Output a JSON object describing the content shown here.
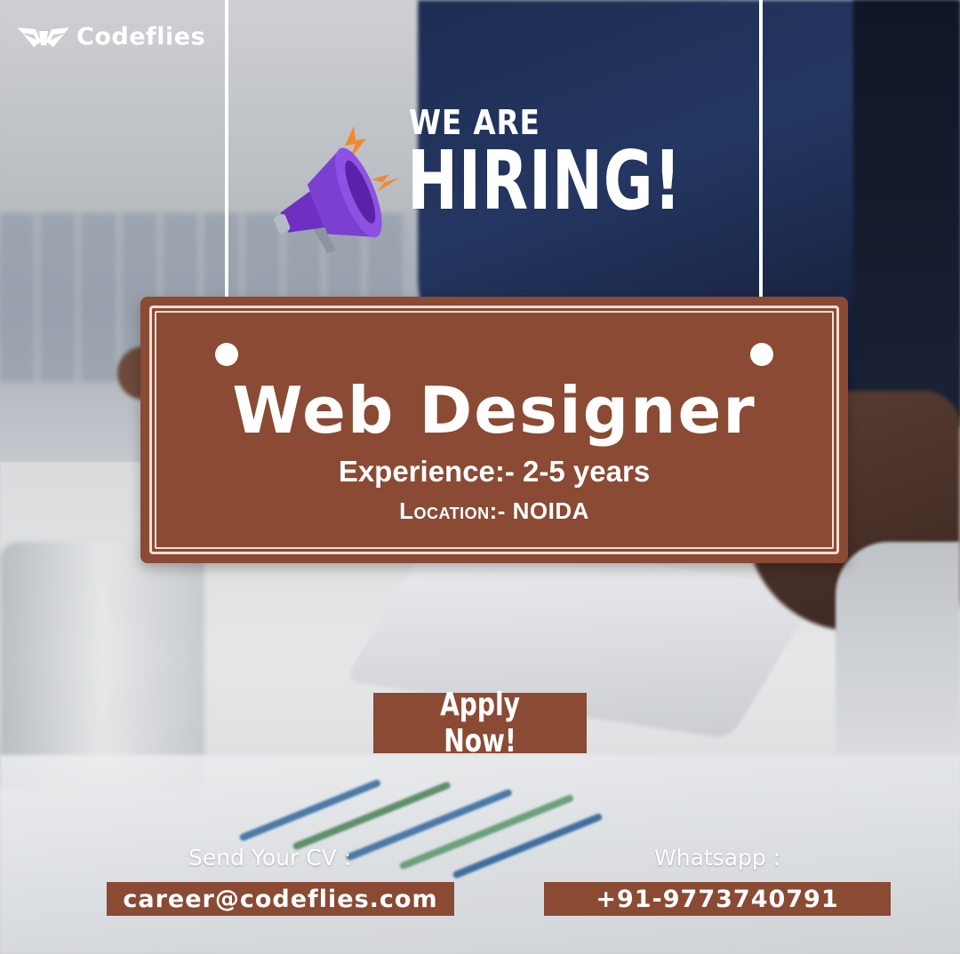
{
  "brand": {
    "name": "Codeflies",
    "logo_icon": "wings-logo-icon"
  },
  "headline": {
    "line1": "WE ARE",
    "line2": "HIRING!",
    "icon": "megaphone-icon"
  },
  "job": {
    "title": "Web Designer",
    "experience": "Experience:- 2-5 years",
    "location": "Location:- NOIDA"
  },
  "cta": {
    "label": "Apply Now!"
  },
  "contact": {
    "cv_label": "Send Your CV :",
    "email": "career@codeflies.com",
    "whatsapp_label": "Whatsapp :",
    "phone": "+91-9773740791"
  },
  "colors": {
    "accent": "#8a4a34",
    "text": "#ffffff",
    "megaphone": "#7b3fd1",
    "spark": "#f08a2c"
  }
}
